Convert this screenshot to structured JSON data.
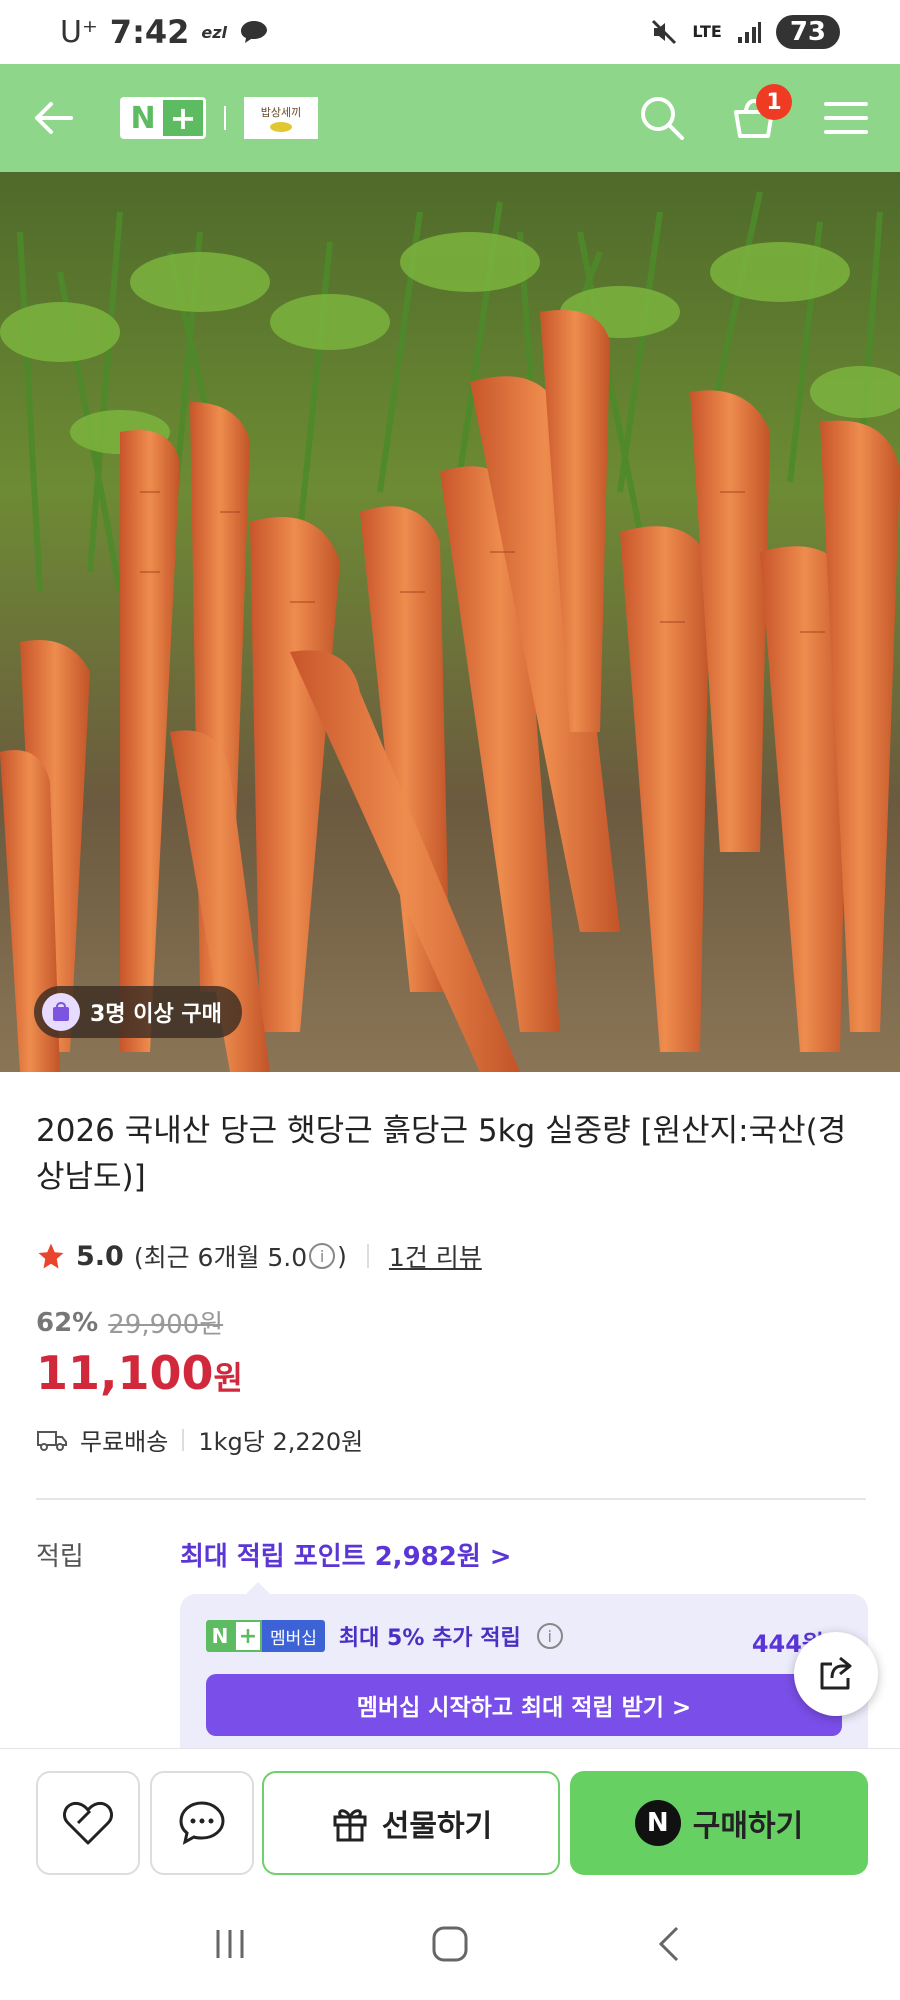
{
  "status_bar": {
    "carrier": "U⁺",
    "time": "7:42",
    "app_indicator": "ezl",
    "network": "LTE",
    "battery": "73"
  },
  "header": {
    "brand_logo_n": "N",
    "brand_logo_plus": "+",
    "store_logo_text": "밥상세끼",
    "cart_count": "1",
    "icons": [
      "back-arrow-icon",
      "search-icon",
      "cart-icon",
      "menu-icon"
    ]
  },
  "product": {
    "group_badge": "3명 이상 구매",
    "title": "2026 국내산 당근 햇당근 흙당근 5kg 실중량 [원산지:국산(경상남도)]",
    "rating": {
      "score": "5.0",
      "recent_prefix": "(최근 6개월 5.0",
      "recent_suffix": ")",
      "review_count": "1건 리뷰"
    },
    "discount_rate": "62%",
    "original_price": "29,900원",
    "price": "11,100",
    "price_unit": "원",
    "shipping": "무료배송",
    "unit_price": "1kg당 2,220원"
  },
  "points": {
    "label": "적립",
    "max_points": "최대 적립 포인트 2,982원 >",
    "membership": {
      "tag_n": "N",
      "tag_plus": "+",
      "tag_label": "멤버십",
      "text": "최대 5% 추가 적립",
      "points": "444원",
      "button": "멤버십 시작하고 최대 적립 받기 >"
    }
  },
  "bottom_bar": {
    "gift_label": "선물하기",
    "buy_label": "구매하기",
    "buy_logo": "N"
  },
  "colors": {
    "header_bg": "#8ed68a",
    "price_red": "#d1283c",
    "accent_purple": "#5b35d5",
    "buy_green": "#66d162"
  }
}
